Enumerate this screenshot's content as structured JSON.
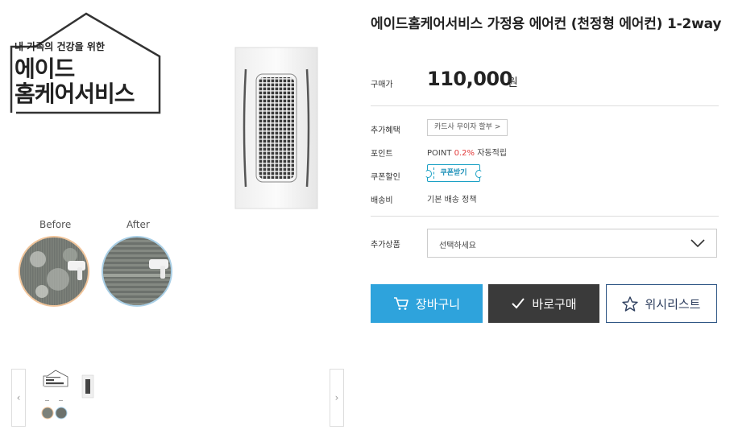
{
  "brand": {
    "tagline": "내 가족의 건강을 위한",
    "name_line1": "에이드",
    "name_line2": "홈케어서비스"
  },
  "before_after": {
    "before_label": "Before",
    "after_label": "After"
  },
  "product": {
    "title": "에이드홈케어서비스 가정용 에어컨 (천정형 에어컨) 1-2way",
    "price_label": "구매가",
    "price_value": "110,000",
    "price_unit": "원"
  },
  "info": {
    "benefit_label": "추가혜택",
    "benefit_button": "카드사 무이자 할부 >",
    "point_label": "포인트",
    "point_prefix": "POINT ",
    "point_rate": "0.2%",
    "point_suffix": " 자동적립",
    "coupon_label": "쿠폰할인",
    "coupon_button": "쿠폰받기",
    "shipping_label": "배송비",
    "shipping_value": "기본 배송 정책"
  },
  "option": {
    "label": "추가상품",
    "selected": "선택하세요"
  },
  "actions": {
    "cart": "장바구니",
    "buy": "바로구매",
    "wishlist": "위시리스트"
  },
  "thumbnails": {
    "prev": "‹",
    "next": "›"
  },
  "colors": {
    "cart_bg": "#2ea3dc",
    "buy_bg": "#3a3a3a",
    "wishlist_border": "#2d5584",
    "point_accent": "#e23b3b",
    "coupon_accent": "#1aa0c4"
  }
}
